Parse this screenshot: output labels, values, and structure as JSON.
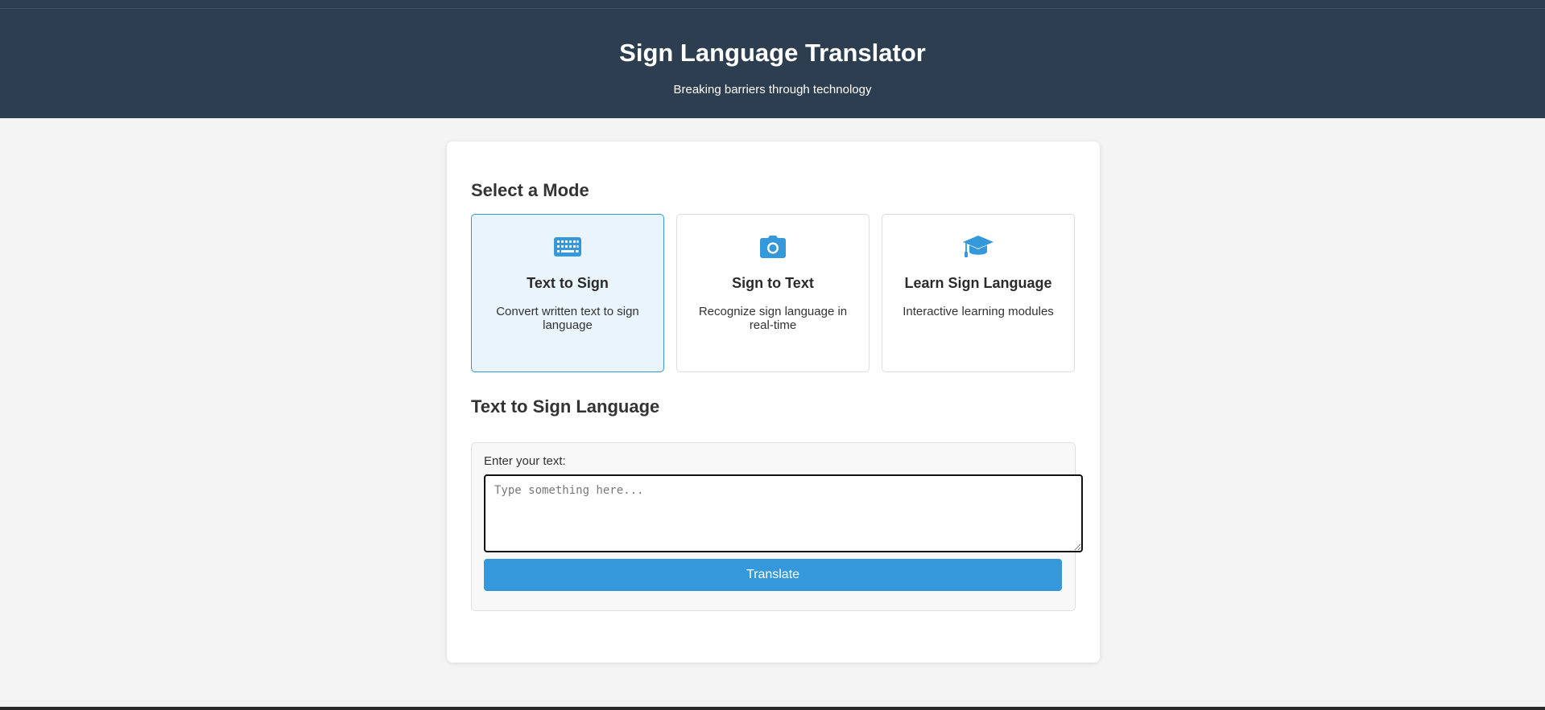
{
  "header": {
    "title": "Sign Language Translator",
    "subtitle": "Breaking barriers through technology"
  },
  "modes_section": {
    "title": "Select a Mode",
    "items": [
      {
        "icon": "keyboard-icon",
        "title": "Text to Sign",
        "description": "Convert written text to sign language",
        "active": true
      },
      {
        "icon": "camera-icon",
        "title": "Sign to Text",
        "description": "Recognize sign language in real-time",
        "active": false
      },
      {
        "icon": "graduation-cap-icon",
        "title": "Learn Sign Language",
        "description": "Interactive learning modules",
        "active": false
      }
    ]
  },
  "text_to_sign": {
    "title": "Text to Sign Language",
    "input_label": "Enter your text:",
    "input_value": "",
    "input_placeholder": "Type something here...",
    "button_label": "Translate"
  },
  "colors": {
    "header_bg": "#2c3e50",
    "accent": "#3498db",
    "active_card_bg": "#eaf4fc",
    "page_bg": "#f4f4f4"
  }
}
